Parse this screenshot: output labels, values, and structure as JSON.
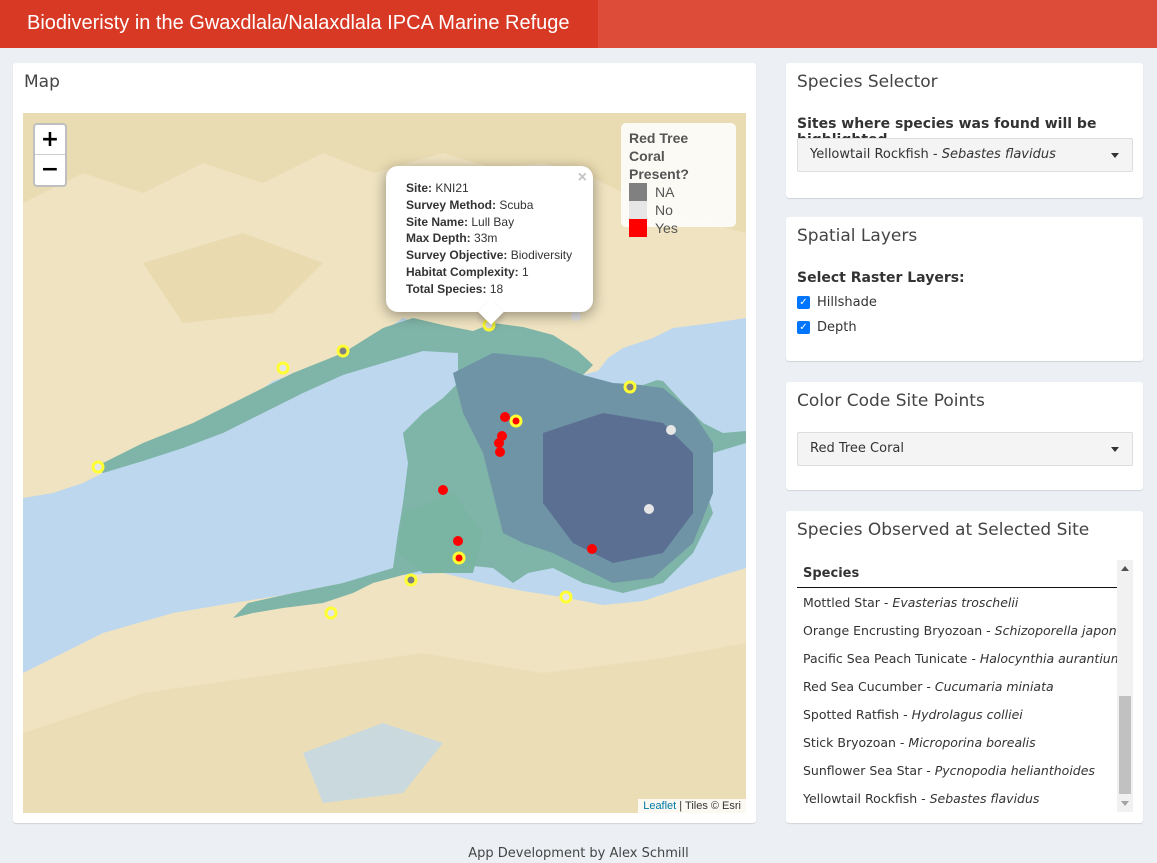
{
  "header": {
    "title": "Biodiveristy in the Gwaxdlala/Nalaxdlala IPCA Marine Refuge"
  },
  "map_box": {
    "title": "Map",
    "zoom_in": "+",
    "zoom_out": "−",
    "legend": {
      "title_line1": "Red Tree",
      "title_line2": "Coral Present?",
      "items": [
        {
          "label": "NA",
          "color": "#808080"
        },
        {
          "label": "No",
          "color": "#e6e6e6"
        },
        {
          "label": "Yes",
          "color": "#ff0000"
        }
      ]
    },
    "popup": {
      "close": "×",
      "rows": [
        {
          "key": "Site:",
          "value": "KNI21"
        },
        {
          "key": "Survey Method:",
          "value": "Scuba"
        },
        {
          "key": "Site Name:",
          "value": "Lull Bay"
        },
        {
          "key": "Max Depth:",
          "value": "33m"
        },
        {
          "key": "Survey Objective:",
          "value": "Biodiversity"
        },
        {
          "key": "Habitat Complexity:",
          "value": "1"
        },
        {
          "key": "Total Species:",
          "value": "18"
        }
      ]
    },
    "attribution": {
      "link": "Leaflet",
      "text": "| Tiles © Esri"
    },
    "colors": {
      "water": "#bcd7ee",
      "land": "#efe3c1",
      "yes": "#ff0000",
      "no": "#e6e6e6",
      "highlight": "#ffff33"
    }
  },
  "species_selector": {
    "title": "Species Selector",
    "label": "Sites where species was found will be highlighted",
    "selected_common": "Yellowtail Rockfish",
    "selected_sep": " - ",
    "selected_latin": "Sebastes flavidus"
  },
  "spatial_layers": {
    "title": "Spatial Layers",
    "label": "Select Raster Layers:",
    "options": [
      {
        "label": "Hillshade",
        "checked": true
      },
      {
        "label": "Depth",
        "checked": true
      }
    ]
  },
  "color_code": {
    "title": "Color Code Site Points",
    "selected": "Red Tree Coral"
  },
  "species_observed": {
    "title": "Species Observed at Selected Site",
    "column": "Species",
    "rows": [
      {
        "common": "Mottled Star",
        "latin": "Evasterias troschelii"
      },
      {
        "common": "Orange Encrusting Bryozoan",
        "latin": "Schizoporella japonica"
      },
      {
        "common": "Pacific Sea Peach Tunicate",
        "latin": "Halocynthia aurantium"
      },
      {
        "common": "Red Sea Cucumber",
        "latin": "Cucumaria miniata"
      },
      {
        "common": "Spotted Ratfish",
        "latin": "Hydrolagus colliei"
      },
      {
        "common": "Stick Bryozoan",
        "latin": "Microporina borealis"
      },
      {
        "common": "Sunflower Sea Star",
        "latin": "Pycnopodia helianthoides"
      },
      {
        "common": "Yellowtail Rockfish",
        "latin": "Sebastes flavidus"
      }
    ]
  },
  "footer": {
    "text": "App Development by Alex Schmill"
  }
}
